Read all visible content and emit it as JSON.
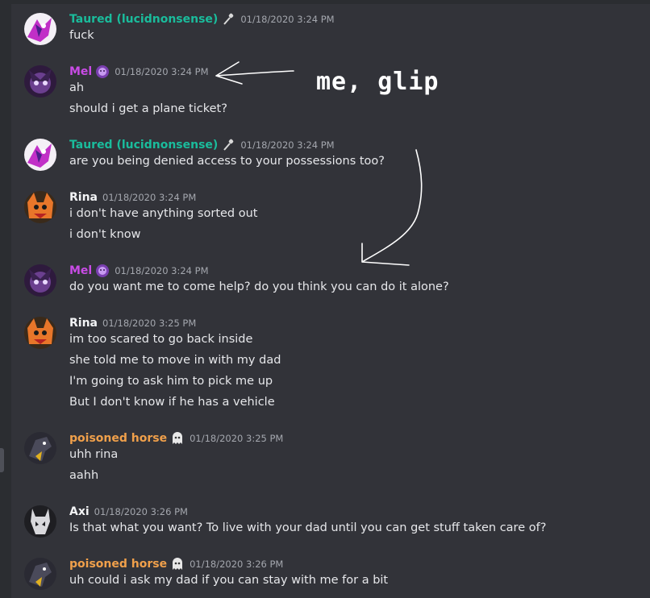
{
  "colors": {
    "background": "#323339",
    "teal": "#1abc9c",
    "purple": "#c94ce6",
    "white": "#f2f3f5",
    "orange": "#f0a04b"
  },
  "messages": [
    {
      "author": "Taured (lucidnonsense)",
      "badge_icon": "microphone-icon",
      "timestamp": "01/18/2020 3:24 PM",
      "lines": [
        "fuck"
      ]
    },
    {
      "author": "Mel",
      "badge_icon": "purple-face-icon",
      "timestamp": "01/18/2020 3:24 PM",
      "lines": [
        "ah",
        "should i get a plane ticket?"
      ]
    },
    {
      "author": "Taured (lucidnonsense)",
      "badge_icon": "microphone-icon",
      "timestamp": "01/18/2020 3:24 PM",
      "lines": [
        "are you being denied access to your possessions too?"
      ]
    },
    {
      "author": "Rina",
      "timestamp": "01/18/2020 3:24 PM",
      "lines": [
        "i don't have anything sorted out",
        "i don't know"
      ]
    },
    {
      "author": "Mel",
      "badge_icon": "purple-face-icon",
      "timestamp": "01/18/2020 3:24 PM",
      "lines": [
        "do you want me to come help? do you think you can do it alone?"
      ]
    },
    {
      "author": "Rina",
      "timestamp": "01/18/2020 3:25 PM",
      "lines": [
        "im too scared to go back inside",
        "she told me to move in with my dad",
        "I'm going to ask him to pick me up",
        "But I don't know if he has a vehicle"
      ]
    },
    {
      "author": "poisoned horse",
      "badge_icon": "ghost-icon",
      "timestamp": "01/18/2020 3:25 PM",
      "lines": [
        "uhh rina",
        "aahh"
      ]
    },
    {
      "author": "Axi",
      "timestamp": "01/18/2020 3:26 PM",
      "lines": [
        "Is that what you want? To live with your dad until you can get stuff taken care of?"
      ]
    },
    {
      "author": "poisoned horse",
      "badge_icon": "ghost-icon",
      "timestamp": "01/18/2020 3:26 PM",
      "lines": [
        "uh could i ask my dad if you can stay with me for a bit"
      ]
    }
  ],
  "annotation": {
    "text": "me, glip"
  }
}
